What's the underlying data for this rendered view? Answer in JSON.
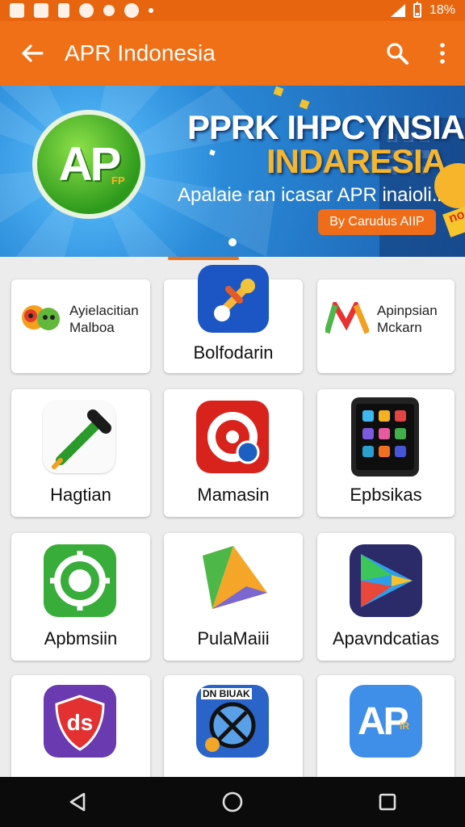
{
  "status_bar": {
    "battery": "18%",
    "icons": [
      "notification-icon",
      "app-icon",
      "data-icon",
      "spotify-icon",
      "paw-icon",
      "chrome-icon",
      "dot-icon",
      "signal-icon",
      "battery-icon"
    ]
  },
  "app_bar": {
    "title": "APR Indonesia",
    "back_icon": "arrow-left-icon",
    "search_icon": "search-icon",
    "menu_icon": "more-vertical-icon"
  },
  "banner": {
    "logo_text": "AP",
    "logo_small": "FP",
    "headline_1": "PPRK IHPCYNSIA",
    "headline_2": "INDARESIA",
    "subtitle": "Apalaie ran icasar APR inaioli.l",
    "button_label": "By Carudus AIIP",
    "badge_text": "no",
    "colors": {
      "accent": "#f07018",
      "headline_2": "#f7b52c",
      "background": "#1b5fae"
    }
  },
  "apps": [
    {
      "name": "Ayielacitian\nMalboa",
      "line1": "Ayielacitian",
      "line2": "Malboa",
      "icon": "chat-bubbles-icon"
    },
    {
      "name": "Bolfodarin",
      "icon": "tool-icon"
    },
    {
      "line1": "Apinpsian",
      "line2": "Mckarn",
      "icon": "colorful-m-icon"
    },
    {
      "name": "Hagtian",
      "icon": "pencil-icon"
    },
    {
      "name": "Mamasin",
      "icon": "target-icon"
    },
    {
      "name": "Epbsikas",
      "icon": "phone-icon"
    },
    {
      "name": "Apbmsiin",
      "icon": "gear-icon"
    },
    {
      "name": "PulaMaiii",
      "icon": "origami-icon"
    },
    {
      "name": "Apavndcatias",
      "icon": "play-icon"
    },
    {
      "name": "",
      "icon": "shield-icon"
    },
    {
      "name": "",
      "icon": "badge-icon",
      "icon_text": "DN BIUAK"
    },
    {
      "name": "",
      "icon": "apr-logo-icon",
      "icon_text": "AP",
      "icon_small": "IR"
    }
  ],
  "nav_bar": {
    "back": "nav-back-icon",
    "home": "nav-home-icon",
    "recents": "nav-recents-icon"
  }
}
